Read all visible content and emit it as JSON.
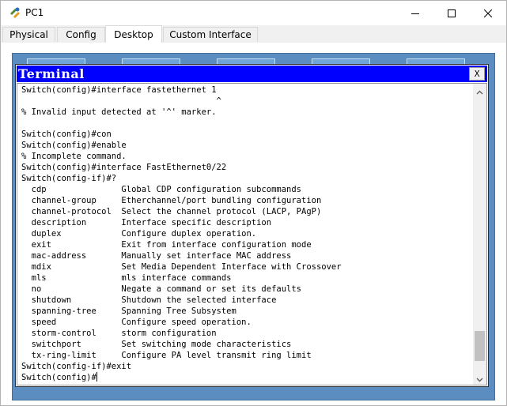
{
  "window": {
    "title": "PC1"
  },
  "tabs": [
    {
      "label": "Physical",
      "active": false
    },
    {
      "label": "Config",
      "active": false
    },
    {
      "label": "Desktop",
      "active": true
    },
    {
      "label": "Custom Interface",
      "active": false
    }
  ],
  "terminal": {
    "title": "Terminal",
    "close_label": "X",
    "lines": [
      "Switch(config)#interface fastethernet 1",
      "                                       ^",
      "% Invalid input detected at '^' marker.",
      "",
      "Switch(config)#con",
      "Switch(config)#enable",
      "% Incomplete command.",
      "Switch(config)#interface FastEthernet0/22",
      "Switch(config-if)#?",
      "  cdp               Global CDP configuration subcommands",
      "  channel-group     Etherchannel/port bundling configuration",
      "  channel-protocol  Select the channel protocol (LACP, PAgP)",
      "  description       Interface specific description",
      "  duplex            Configure duplex operation.",
      "  exit              Exit from interface configuration mode",
      "  mac-address       Manually set interface MAC address",
      "  mdix              Set Media Dependent Interface with Crossover",
      "  mls               mls interface commands",
      "  no                Negate a command or set its defaults",
      "  shutdown          Shutdown the selected interface",
      "  spanning-tree     Spanning Tree Subsystem",
      "  speed             Configure speed operation.",
      "  storm-control     storm configuration",
      "  switchport        Set switching mode characteristics",
      "  tx-ring-limit     Configure PA level transmit ring limit",
      "Switch(config-if)#exit"
    ],
    "prompt": "Switch(config)#"
  },
  "icons": {
    "app": "packet-tracer-pc-icon",
    "minimize": "minimize-icon",
    "maximize": "maximize-icon",
    "close": "close-icon",
    "scroll_up": "scroll-up-arrow-icon",
    "scroll_down": "scroll-down-arrow-icon"
  },
  "colors": {
    "terminal_titlebar": "#0000ff",
    "desktop_background": "#5b8dc1"
  }
}
